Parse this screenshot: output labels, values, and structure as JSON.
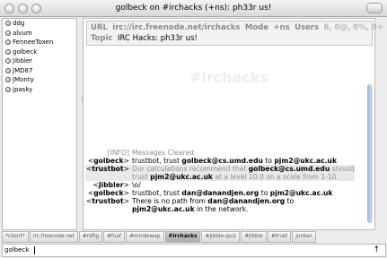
{
  "window": {
    "title": "golbeck on #irchacks (+ns): ph33r us!"
  },
  "users": [
    "ddg",
    "alvum",
    "FenneeToxen",
    "golbeck",
    "Jibbler",
    "JMD87",
    "JMonty",
    "jpasky"
  ],
  "info": {
    "url_label": "URL",
    "url": "irc://irc.freenode.net/irchacks",
    "mode_label": "Mode",
    "mode": "+ns",
    "users_label": "Users",
    "users_value": "8, 0@, 0%, 0+",
    "topic_label": "Topic",
    "topic": "IRC Hacks: ph33r us!"
  },
  "watermark": "#irchacks",
  "messages": [
    {
      "nick": "[INFO]",
      "text": "Messages Cleared."
    },
    {
      "nick": "golbeck",
      "parts": [
        "trustbot, trust ",
        "golbeck@cs.umd.edu",
        " to ",
        "pjm2@ukc.ac.uk"
      ]
    },
    {
      "nick": "trustbot",
      "parts": [
        "Our calculations recommend that ",
        "golbeck@cs.umd.edu",
        " should trust ",
        "pjm2@ukc.ac.uk",
        " at a level 10.0 on a scale from 1-10."
      ]
    },
    {
      "nick": "Jibbler",
      "text": "\\o/"
    },
    {
      "nick": "golbeck",
      "parts": [
        "trustbot, trust ",
        "dan@danandjen.org",
        " to ",
        "pjm2@ukc.ac.uk"
      ]
    },
    {
      "nick": "trustbot",
      "parts": [
        "There is no path from ",
        "dan@danandjen.org",
        " to ",
        "pjm2@ukc.ac.uk",
        " in the network."
      ]
    }
  ],
  "tabs": [
    "*client*",
    "irc.freenode.net",
    "#rdfig",
    "#foaf",
    "#mindswap",
    "#irchacks",
    "#jibble-quiz",
    "#jibble",
    "#trust",
    "jordan"
  ],
  "selected_tab": "#irchacks",
  "input": {
    "nick": "golbeck",
    "value": ""
  }
}
